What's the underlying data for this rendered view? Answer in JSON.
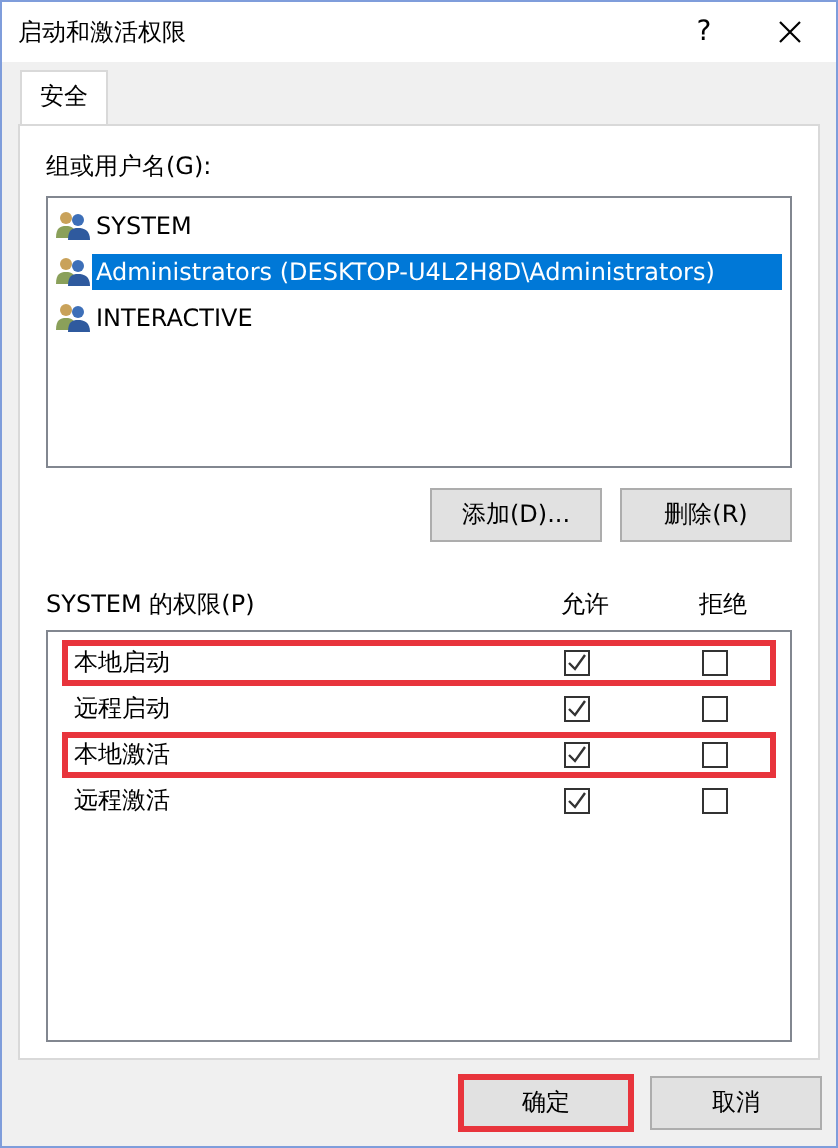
{
  "window": {
    "title": "启动和激活权限",
    "help_button": "?"
  },
  "tabs": [
    {
      "label": "安全",
      "selected": true
    }
  ],
  "users": {
    "label": "组或用户名(G):",
    "items": [
      {
        "name": "SYSTEM",
        "selected": false
      },
      {
        "name": "Administrators (DESKTOP-U4L2H8D\\Administrators)",
        "selected": true
      },
      {
        "name": "INTERACTIVE",
        "selected": false
      }
    ]
  },
  "user_buttons": [
    {
      "label": "添加(D)..."
    },
    {
      "label": "删除(R)"
    }
  ],
  "permissions": {
    "label": "SYSTEM 的权限(P)",
    "columns": [
      "允许",
      "拒绝"
    ],
    "rows": [
      {
        "name": "本地启动",
        "allow": true,
        "deny": false,
        "highlighted": true
      },
      {
        "name": "远程启动",
        "allow": true,
        "deny": false,
        "highlighted": false
      },
      {
        "name": "本地激活",
        "allow": true,
        "deny": false,
        "highlighted": true
      },
      {
        "name": "远程激活",
        "allow": true,
        "deny": false,
        "highlighted": false
      }
    ]
  },
  "footer_buttons": [
    {
      "label": "确定",
      "highlighted": true
    },
    {
      "label": "取消",
      "highlighted": false
    }
  ]
}
